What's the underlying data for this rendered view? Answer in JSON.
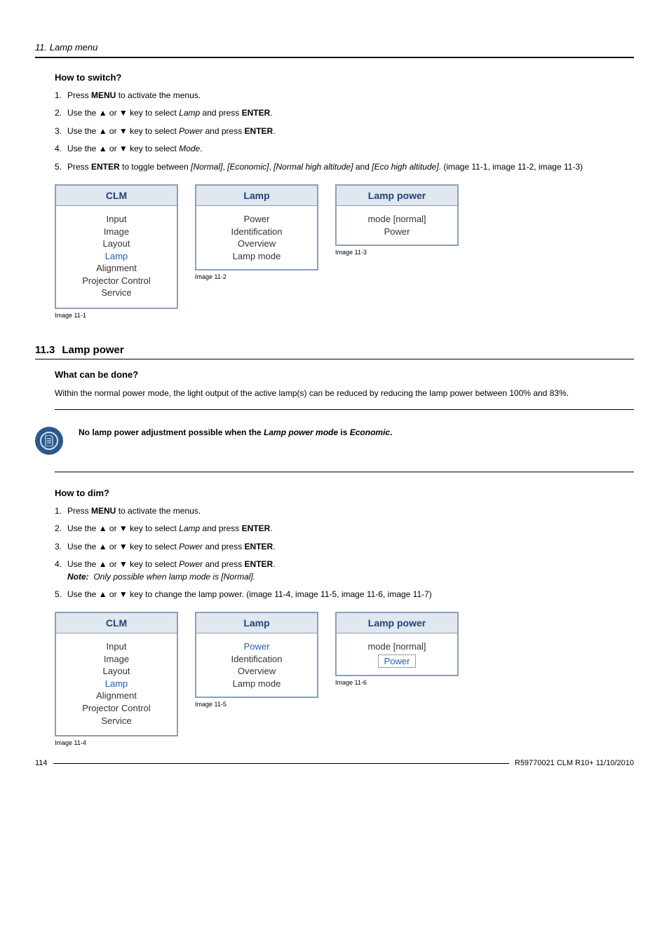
{
  "running_header": "11. Lamp menu",
  "section1": {
    "heading": "How to switch?",
    "steps": [
      {
        "n": "1.",
        "pre": "Press ",
        "b1": "MENU",
        "post": " to activate the menus."
      },
      {
        "n": "2.",
        "pre": "Use the ▲ or ▼ key to select ",
        "i1": "Lamp",
        "mid": " and press ",
        "b1": "ENTER",
        "post": "."
      },
      {
        "n": "3.",
        "pre": "Use the ▲ or ▼ key to select ",
        "i1": "Power",
        "mid": " and press ",
        "b1": "ENTER",
        "post": "."
      },
      {
        "n": "4.",
        "pre": "Use the ▲ or ▼ key to select ",
        "i1": "Mode",
        "post": "."
      },
      {
        "n": "5.",
        "pre": "Press ",
        "b1": "ENTER",
        "mid": " to toggle between ",
        "i1": "[Normal]",
        "c1": ", ",
        "i2": "[Economic]",
        "c2": ", ",
        "i3": "[Normal high altitude]",
        "c3": " and ",
        "i4": "[Eco high altitude]",
        "post": ". (image 11-1, image 11-2, image 11-3)"
      }
    ]
  },
  "fig_set1": {
    "a": {
      "title": "CLM",
      "items": [
        "Input",
        "Image",
        "Layout",
        "Lamp",
        "Alignment",
        "Projector Control",
        "Service"
      ],
      "highlight_index": 3,
      "caption": "Image 11-1"
    },
    "b": {
      "title": "Lamp",
      "items": [
        "Power",
        "Identification",
        "Overview",
        "Lamp mode"
      ],
      "caption": "Image 11-2"
    },
    "c": {
      "title": "Lamp power",
      "items": [
        "mode [normal]",
        "Power"
      ],
      "caption": "Image 11-3"
    }
  },
  "section_header": {
    "number": "11.3",
    "title": "Lamp power"
  },
  "section2a": {
    "heading": "What can be done?",
    "text": "Within the normal power mode, the light output of the active lamp(s) can be reduced by reducing the lamp power between 100% and 83%."
  },
  "notebox": {
    "pre": "No lamp power adjustment possible when the ",
    "i1": "Lamp power mode",
    "mid": " is ",
    "i2": "Economic",
    "post": "."
  },
  "section2b": {
    "heading": "How to dim?",
    "steps": [
      {
        "n": "1.",
        "pre": "Press ",
        "b1": "MENU",
        "post": " to activate the menus."
      },
      {
        "n": "2.",
        "pre": "Use the ▲ or ▼ key to select ",
        "i1": "Lamp",
        "mid": " and press ",
        "b1": "ENTER",
        "post": "."
      },
      {
        "n": "3.",
        "pre": "Use the ▲ or ▼ key to select ",
        "i1": "Power",
        "mid": " and press ",
        "b1": "ENTER",
        "post": "."
      },
      {
        "n": "4.",
        "pre": "Use the ▲ or ▼ key to select ",
        "i1": "Power",
        "mid": " and press ",
        "b1": "ENTER",
        "post": ".",
        "note_label": "Note:",
        "note_text": "Only possible when lamp mode is [Normal]."
      },
      {
        "n": "5.",
        "pre": "Use the ▲ or ▼ key to change the lamp power. (image 11-4, image 11-5, image 11-6, image 11-7)"
      }
    ]
  },
  "fig_set2": {
    "a": {
      "title": "CLM",
      "items": [
        "Input",
        "Image",
        "Layout",
        "Lamp",
        "Alignment",
        "Projector Control",
        "Service"
      ],
      "highlight_index": 3,
      "caption": "Image 11-4"
    },
    "b": {
      "title": "Lamp",
      "items": [
        "Power",
        "Identification",
        "Overview",
        "Lamp mode"
      ],
      "highlight_index": 0,
      "caption": "Image 11-5"
    },
    "c": {
      "title": "Lamp power",
      "items": [
        "mode [normal]",
        "Power"
      ],
      "highlight_index": 1,
      "box": true,
      "caption": "Image 11-6"
    }
  },
  "footer": {
    "page": "114",
    "doc": "R59770021 CLM R10+ 11/10/2010"
  }
}
